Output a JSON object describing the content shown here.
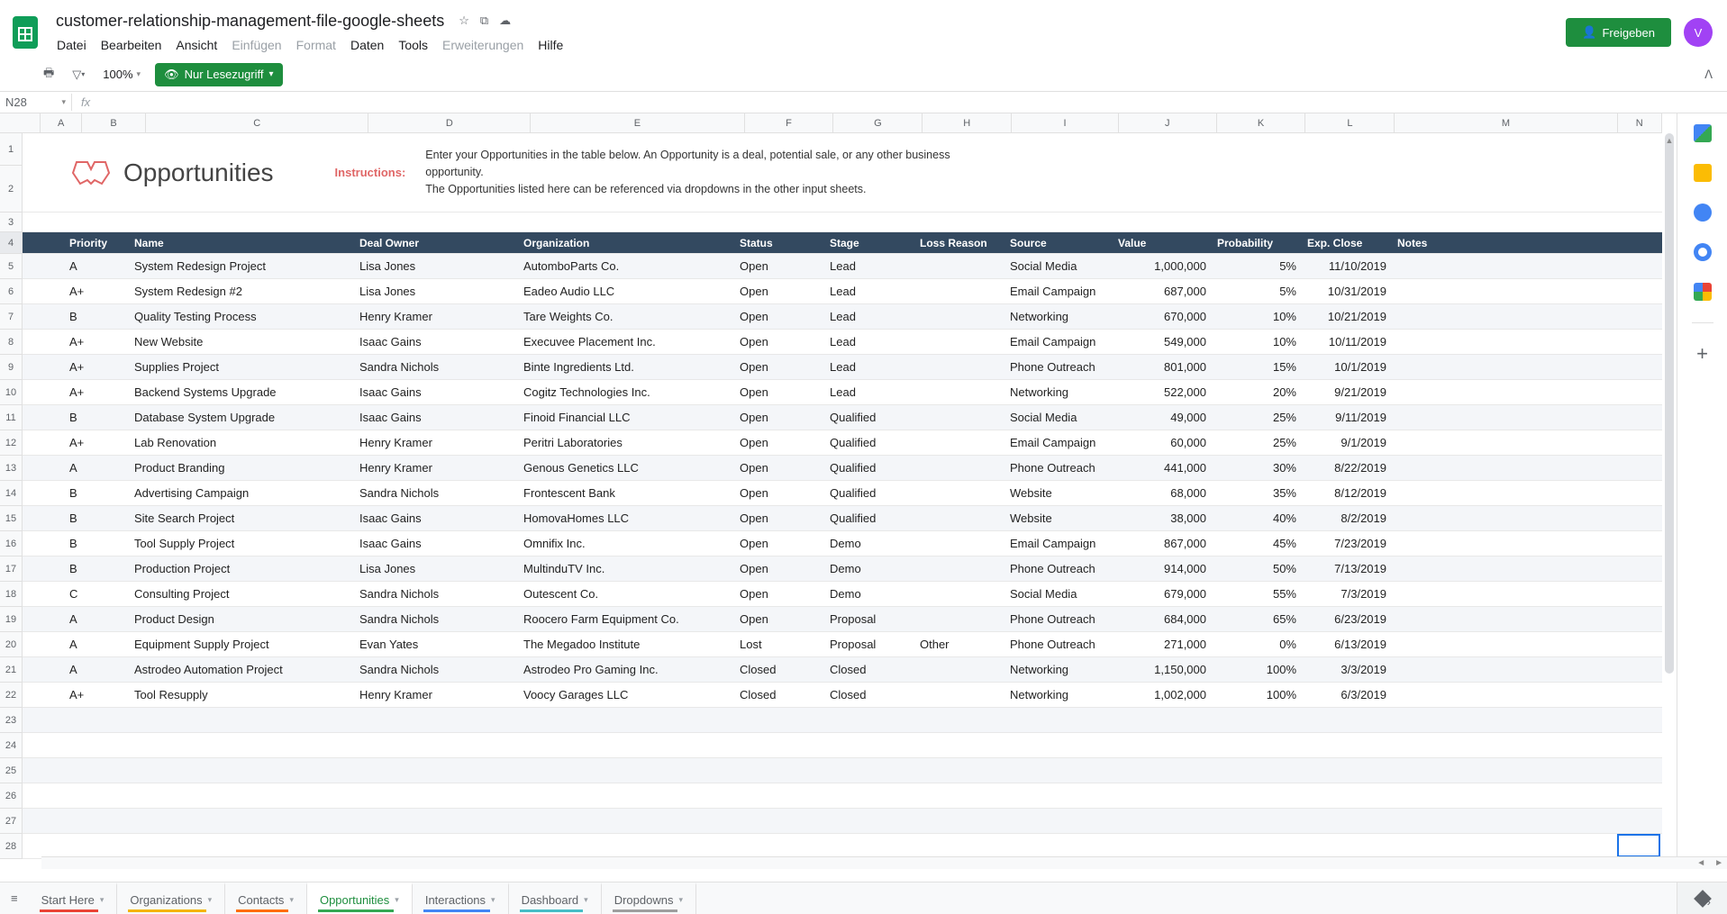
{
  "doc": {
    "title": "customer-relationship-management-file-google-sheets",
    "share_label": "Freigeben",
    "avatar_letter": "V"
  },
  "menu": {
    "items": [
      {
        "label": "Datei",
        "disabled": false
      },
      {
        "label": "Bearbeiten",
        "disabled": false
      },
      {
        "label": "Ansicht",
        "disabled": false
      },
      {
        "label": "Einfügen",
        "disabled": true
      },
      {
        "label": "Format",
        "disabled": true
      },
      {
        "label": "Daten",
        "disabled": false
      },
      {
        "label": "Tools",
        "disabled": false
      },
      {
        "label": "Erweiterungen",
        "disabled": true
      },
      {
        "label": "Hilfe",
        "disabled": false
      }
    ]
  },
  "toolbar": {
    "zoom": "100%",
    "readonly_label": "Nur Lesezugriff"
  },
  "formula": {
    "cell_ref": "N28",
    "fx": "fx"
  },
  "grid": {
    "columns": [
      "A",
      "B",
      "C",
      "D",
      "E",
      "F",
      "G",
      "H",
      "I",
      "J",
      "K",
      "L",
      "M",
      "N"
    ],
    "title": "Opportunities",
    "instructions_label": "Instructions:",
    "instructions_text": "Enter your Opportunities in the table below. An Opportunity is a deal, potential sale, or any other business opportunity.\nThe Opportunities listed here can be referenced via dropdowns in the other input sheets.",
    "headers": [
      "Priority",
      "Name",
      "Deal Owner",
      "Organization",
      "Status",
      "Stage",
      "Loss Reason",
      "Source",
      "Value",
      "Probability",
      "Exp. Close",
      "Notes"
    ],
    "rows": [
      {
        "priority": "A",
        "name": "System Redesign Project",
        "owner": "Lisa Jones",
        "org": "AutomboParts Co.",
        "status": "Open",
        "stage": "Lead",
        "loss": "",
        "source": "Social Media",
        "value": "1,000,000",
        "prob": "5%",
        "close": "11/10/2019",
        "notes": ""
      },
      {
        "priority": "A+",
        "name": "System Redesign #2",
        "owner": "Lisa Jones",
        "org": "Eadeo Audio LLC",
        "status": "Open",
        "stage": "Lead",
        "loss": "",
        "source": "Email Campaign",
        "value": "687,000",
        "prob": "5%",
        "close": "10/31/2019",
        "notes": ""
      },
      {
        "priority": "B",
        "name": "Quality Testing Process",
        "owner": "Henry Kramer",
        "org": "Tare Weights Co.",
        "status": "Open",
        "stage": "Lead",
        "loss": "",
        "source": "Networking",
        "value": "670,000",
        "prob": "10%",
        "close": "10/21/2019",
        "notes": ""
      },
      {
        "priority": "A+",
        "name": "New Website",
        "owner": "Isaac Gains",
        "org": "Execuvee Placement Inc.",
        "status": "Open",
        "stage": "Lead",
        "loss": "",
        "source": "Email Campaign",
        "value": "549,000",
        "prob": "10%",
        "close": "10/11/2019",
        "notes": ""
      },
      {
        "priority": "A+",
        "name": "Supplies Project",
        "owner": "Sandra Nichols",
        "org": "Binte Ingredients Ltd.",
        "status": "Open",
        "stage": "Lead",
        "loss": "",
        "source": "Phone Outreach",
        "value": "801,000",
        "prob": "15%",
        "close": "10/1/2019",
        "notes": ""
      },
      {
        "priority": "A+",
        "name": "Backend Systems Upgrade",
        "owner": "Isaac Gains",
        "org": "Cogitz Technologies Inc.",
        "status": "Open",
        "stage": "Lead",
        "loss": "",
        "source": "Networking",
        "value": "522,000",
        "prob": "20%",
        "close": "9/21/2019",
        "notes": ""
      },
      {
        "priority": "B",
        "name": "Database System Upgrade",
        "owner": "Isaac Gains",
        "org": "Finoid Financial LLC",
        "status": "Open",
        "stage": "Qualified",
        "loss": "",
        "source": "Social Media",
        "value": "49,000",
        "prob": "25%",
        "close": "9/11/2019",
        "notes": ""
      },
      {
        "priority": "A+",
        "name": "Lab Renovation",
        "owner": "Henry Kramer",
        "org": "Peritri Laboratories",
        "status": "Open",
        "stage": "Qualified",
        "loss": "",
        "source": "Email Campaign",
        "value": "60,000",
        "prob": "25%",
        "close": "9/1/2019",
        "notes": ""
      },
      {
        "priority": "A",
        "name": "Product Branding",
        "owner": "Henry Kramer",
        "org": "Genous Genetics LLC",
        "status": "Open",
        "stage": "Qualified",
        "loss": "",
        "source": "Phone Outreach",
        "value": "441,000",
        "prob": "30%",
        "close": "8/22/2019",
        "notes": ""
      },
      {
        "priority": "B",
        "name": "Advertising Campaign",
        "owner": "Sandra Nichols",
        "org": "Frontescent Bank",
        "status": "Open",
        "stage": "Qualified",
        "loss": "",
        "source": "Website",
        "value": "68,000",
        "prob": "35%",
        "close": "8/12/2019",
        "notes": ""
      },
      {
        "priority": "B",
        "name": "Site Search Project",
        "owner": "Isaac Gains",
        "org": "HomovaHomes LLC",
        "status": "Open",
        "stage": "Qualified",
        "loss": "",
        "source": "Website",
        "value": "38,000",
        "prob": "40%",
        "close": "8/2/2019",
        "notes": ""
      },
      {
        "priority": "B",
        "name": "Tool Supply Project",
        "owner": "Isaac Gains",
        "org": "Omnifix Inc.",
        "status": "Open",
        "stage": "Demo",
        "loss": "",
        "source": "Email Campaign",
        "value": "867,000",
        "prob": "45%",
        "close": "7/23/2019",
        "notes": ""
      },
      {
        "priority": "B",
        "name": "Production Project",
        "owner": "Lisa Jones",
        "org": "MultinduTV Inc.",
        "status": "Open",
        "stage": "Demo",
        "loss": "",
        "source": "Phone Outreach",
        "value": "914,000",
        "prob": "50%",
        "close": "7/13/2019",
        "notes": ""
      },
      {
        "priority": "C",
        "name": "Consulting Project",
        "owner": "Sandra Nichols",
        "org": "Outescent Co.",
        "status": "Open",
        "stage": "Demo",
        "loss": "",
        "source": "Social Media",
        "value": "679,000",
        "prob": "55%",
        "close": "7/3/2019",
        "notes": ""
      },
      {
        "priority": "A",
        "name": "Product Design",
        "owner": "Sandra Nichols",
        "org": "Roocero Farm Equipment Co.",
        "status": "Open",
        "stage": "Proposal",
        "loss": "",
        "source": "Phone Outreach",
        "value": "684,000",
        "prob": "65%",
        "close": "6/23/2019",
        "notes": ""
      },
      {
        "priority": "A",
        "name": "Equipment Supply Project",
        "owner": "Evan Yates",
        "org": "The Megadoo Institute",
        "status": "Lost",
        "stage": "Proposal",
        "loss": "Other",
        "source": "Phone Outreach",
        "value": "271,000",
        "prob": "0%",
        "close": "6/13/2019",
        "notes": ""
      },
      {
        "priority": "A",
        "name": "Astrodeo Automation Project",
        "owner": "Sandra Nichols",
        "org": "Astrodeo Pro Gaming Inc.",
        "status": "Closed",
        "stage": "Closed",
        "loss": "",
        "source": "Networking",
        "value": "1,150,000",
        "prob": "100%",
        "close": "3/3/2019",
        "notes": ""
      },
      {
        "priority": "A+",
        "name": "Tool Resupply",
        "owner": "Henry Kramer",
        "org": "Voocy Garages LLC",
        "status": "Closed",
        "stage": "Closed",
        "loss": "",
        "source": "Networking",
        "value": "1,002,000",
        "prob": "100%",
        "close": "6/3/2019",
        "notes": ""
      }
    ]
  },
  "tabs": [
    {
      "label": "Start Here",
      "accent": "#ea4335"
    },
    {
      "label": "Organizations",
      "accent": "#f4b400"
    },
    {
      "label": "Contacts",
      "accent": "#ff6d01"
    },
    {
      "label": "Opportunities",
      "accent": "#34a853",
      "active": true
    },
    {
      "label": "Interactions",
      "accent": "#4285f4"
    },
    {
      "label": "Dashboard",
      "accent": "#46bdc6"
    },
    {
      "label": "Dropdowns",
      "accent": "#9e9e9e"
    }
  ]
}
